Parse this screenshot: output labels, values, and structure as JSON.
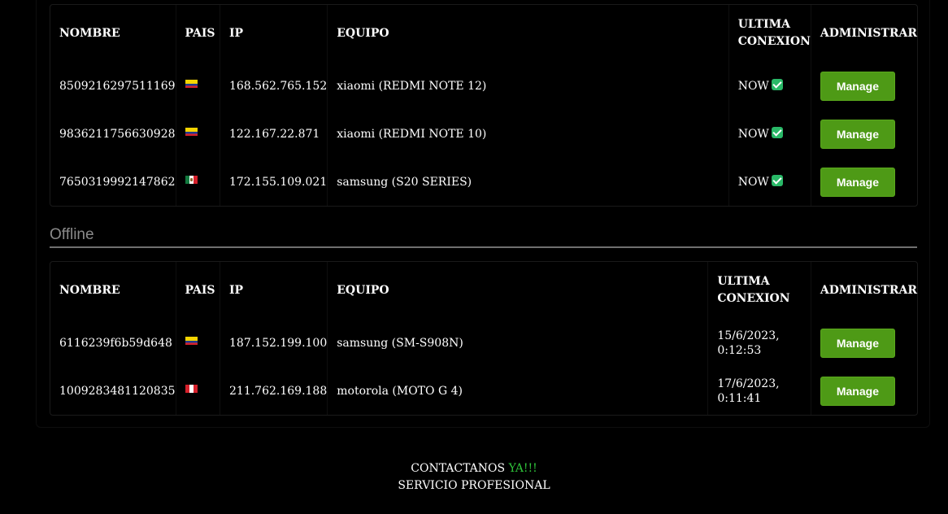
{
  "online_table": {
    "headers": {
      "nombre": "NOMBRE",
      "pais": "PAIS",
      "ip": "IP",
      "equipo": "EQUIPO",
      "ultima_line1": "ULTIMA",
      "ultima_line2": "CONEXION",
      "administrar": "ADMINISTRAR"
    },
    "rows": [
      {
        "nombre": "8509216297511169",
        "flag": "colombia-flag",
        "ip": "168.562.765.152",
        "equipo": "xiaomi (REDMI NOTE 12)",
        "ultima": "NOW",
        "action": "Manage"
      },
      {
        "nombre": "9836211756630928",
        "flag": "colombia-flag",
        "ip": "122.167.22.871",
        "equipo": "xiaomi (REDMI NOTE 10)",
        "ultima": "NOW",
        "action": "Manage"
      },
      {
        "nombre": "7650319992147862",
        "flag": "mexico-flag",
        "ip": "172.155.109.021",
        "equipo": "samsung (S20 SERIES)",
        "ultima": "NOW",
        "action": "Manage"
      }
    ]
  },
  "offline_section": {
    "title": "Offline"
  },
  "offline_table": {
    "headers": {
      "nombre": "NOMBRE",
      "pais": "PAIS",
      "ip": "IP",
      "equipo": "EQUIPO",
      "ultima_line1": "ULTIMA",
      "ultima_line2": "CONEXION",
      "administrar": "ADMINISTRAR"
    },
    "rows": [
      {
        "nombre": "6116239f6b59d648",
        "flag": "colombia-flag",
        "ip": "187.152.199.100",
        "equipo": "samsung (SM-S908N)",
        "ultima": "15/6/2023, 0:12:53",
        "action": "Manage"
      },
      {
        "nombre": "1009283481120835",
        "flag": "peru-flag",
        "ip": "211.762.169.188",
        "equipo": "motorola (MOTO G 4)",
        "ultima": "17/6/2023, 0:11:41",
        "action": "Manage"
      }
    ]
  },
  "footer": {
    "contact": "CONTACTANOS",
    "contact_accent": "YA!!!",
    "service": "SERVICIO PROFESIONAL"
  },
  "colors": {
    "background": "#000000",
    "manage_button": "#4e9a16",
    "status_check": "#29b867",
    "accent_text": "#2fc43a",
    "section_title": "#8a8a8a"
  }
}
